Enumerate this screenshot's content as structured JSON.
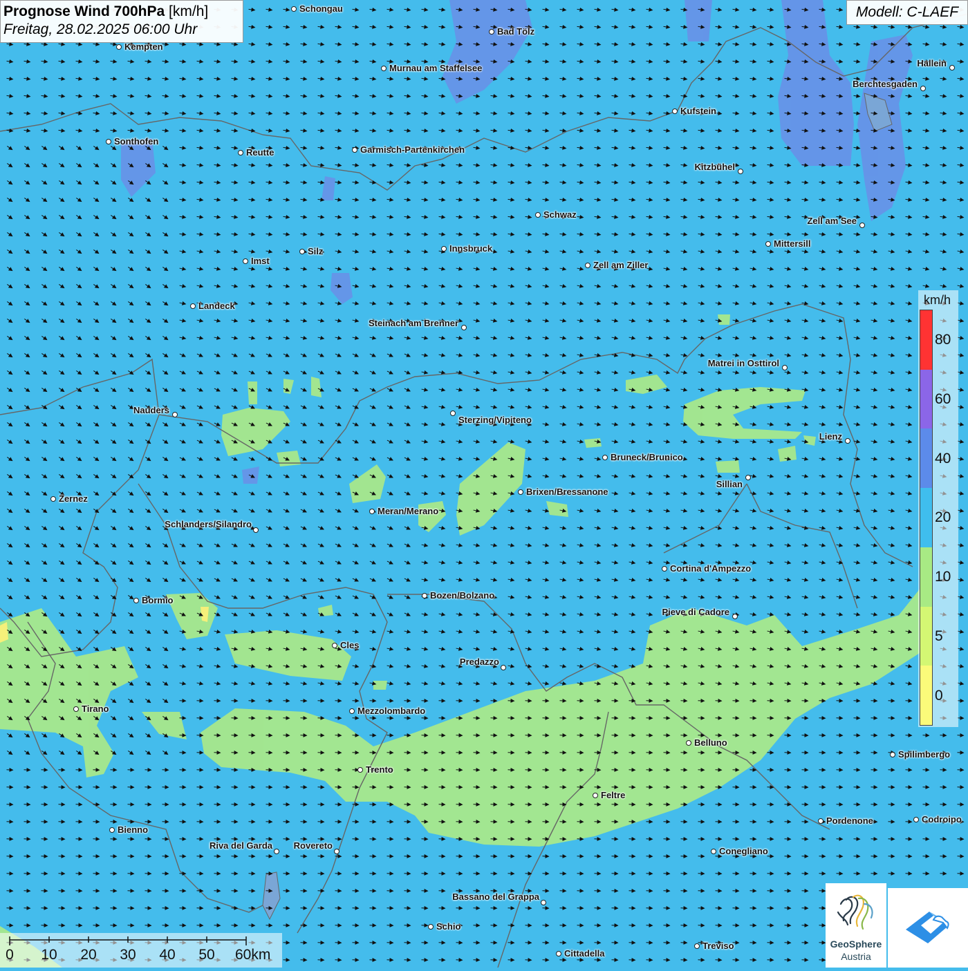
{
  "header": {
    "title_bold": "Prognose Wind 700hPa",
    "title_unit": " [km/h]",
    "date_line": "Freitag, 28.02.2025 06:00 Uhr",
    "model": "Modell: C-LAEF"
  },
  "colors": {
    "background": "#44bcec",
    "calm_green": "#a8e88c",
    "stronger_blue": "#5b86e8",
    "stronger_violet": "#8a6ae8",
    "arrow": "#111111"
  },
  "cities": [
    {
      "name": "Schongau"
    },
    {
      "name": "Bad Tölz"
    },
    {
      "name": "Kempten"
    },
    {
      "name": "Murnau am Staffelsee"
    },
    {
      "name": "Hallein"
    },
    {
      "name": "Berchtesgaden"
    },
    {
      "name": "Kufstein"
    },
    {
      "name": "Sonthofen"
    },
    {
      "name": "Reutte"
    },
    {
      "name": "Garmisch-Partenkirchen"
    },
    {
      "name": "Kitzbühel"
    },
    {
      "name": "Schwaz"
    },
    {
      "name": "Zell am See"
    },
    {
      "name": "Mittersill"
    },
    {
      "name": "Silz"
    },
    {
      "name": "Innsbruck"
    },
    {
      "name": "Imst"
    },
    {
      "name": "Zell am Ziller"
    },
    {
      "name": "Landeck"
    },
    {
      "name": "Steinach am Brenner"
    },
    {
      "name": "Matrei in Osttirol"
    },
    {
      "name": "Nauders"
    },
    {
      "name": "Sterzing/Vipiteno"
    },
    {
      "name": "Lienz"
    },
    {
      "name": "Bruneck/Brunico"
    },
    {
      "name": "Sillian"
    },
    {
      "name": "Brixen/Bressanone"
    },
    {
      "name": "Zernez"
    },
    {
      "name": "Meran/Merano"
    },
    {
      "name": "Schlanders/Silandro"
    },
    {
      "name": "Cortina d'Ampezzo"
    },
    {
      "name": "Bozen/Bolzano"
    },
    {
      "name": "Bormio"
    },
    {
      "name": "Pieve di Cadore"
    },
    {
      "name": "Cles"
    },
    {
      "name": "Predazzo"
    },
    {
      "name": "Tirano"
    },
    {
      "name": "Mezzolombardo"
    },
    {
      "name": "Belluno"
    },
    {
      "name": "Spilimbergo"
    },
    {
      "name": "Trento"
    },
    {
      "name": "Feltre"
    },
    {
      "name": "Pordenone"
    },
    {
      "name": "Codroipo"
    },
    {
      "name": "Bienno"
    },
    {
      "name": "Riva del Garda"
    },
    {
      "name": "Rovereto"
    },
    {
      "name": "Conegliano"
    },
    {
      "name": "Bassano del Grappa"
    },
    {
      "name": "Schio"
    },
    {
      "name": "Treviso"
    },
    {
      "name": "Cittadella"
    }
  ],
  "legend": {
    "unit": "km/h",
    "classes": [
      {
        "label": "0",
        "color": "#fbfb7a"
      },
      {
        "label": "5",
        "color": "#d4f773"
      },
      {
        "label": "10",
        "color": "#a8ea84"
      },
      {
        "label": "20",
        "color": "#3fbeee"
      },
      {
        "label": "40",
        "color": "#5c8bea"
      },
      {
        "label": "60",
        "color": "#8b66e8"
      },
      {
        "label": "80",
        "color": "#ff3333"
      }
    ]
  },
  "scale_bar": {
    "labels": [
      "0",
      "10",
      "20",
      "30",
      "40",
      "50",
      "60km"
    ]
  },
  "logos": {
    "geosphere_line1": "GeoSphere",
    "geosphere_line2": "Austria"
  }
}
